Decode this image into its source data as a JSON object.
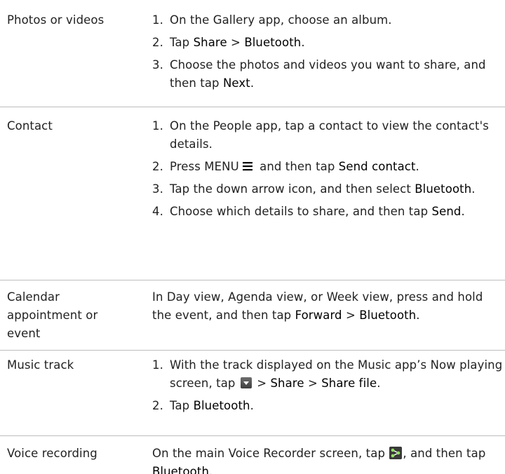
{
  "rows": {
    "photos": {
      "label": "Photos or videos",
      "steps": [
        {
          "num": "1.",
          "parts": [
            "On the Gallery app, choose an album."
          ]
        },
        {
          "num": "2.",
          "parts": [
            "Tap ",
            "Share",
            " > ",
            "Bluetooth",
            "."
          ]
        },
        {
          "num": "3.",
          "parts": [
            "Choose the photos and videos you want to share, and then tap ",
            "Next",
            "."
          ]
        }
      ]
    },
    "contact": {
      "label": "Contact",
      "steps": [
        {
          "num": "1.",
          "parts": [
            "On the People app, tap a contact to view the contact's details."
          ]
        },
        {
          "num": "2.",
          "parts": [
            "Press MENU",
            " and then tap ",
            "Send contact",
            "."
          ]
        },
        {
          "num": "3.",
          "parts": [
            "Tap the down arrow icon, and then select ",
            "Bluetooth",
            "."
          ]
        },
        {
          "num": "4.",
          "parts": [
            "Choose which details to share, and then tap ",
            "Send",
            "."
          ]
        }
      ]
    },
    "calendar": {
      "label": "Calendar appointment or event",
      "parts": [
        "In Day view, Agenda view, or Week view, press and hold the event, and then tap ",
        "Forward",
        " > ",
        "Bluetooth",
        "."
      ]
    },
    "music": {
      "label": "Music track",
      "steps": [
        {
          "num": "1.",
          "parts": [
            "With the track displayed on the Music app’s Now playing screen, tap ",
            " > ",
            "Share",
            " > ",
            "Share file",
            "."
          ]
        },
        {
          "num": "2.",
          "parts": [
            "Tap ",
            "Bluetooth",
            "."
          ]
        }
      ]
    },
    "voice": {
      "label": "Voice recording",
      "parts": [
        "On the main Voice Recorder screen, tap ",
        ", and then tap ",
        "Bluetooth",
        "."
      ]
    }
  },
  "icons": {
    "menu": "menu-icon",
    "down_arrow": "down-arrow-icon",
    "share": "share-icon"
  }
}
